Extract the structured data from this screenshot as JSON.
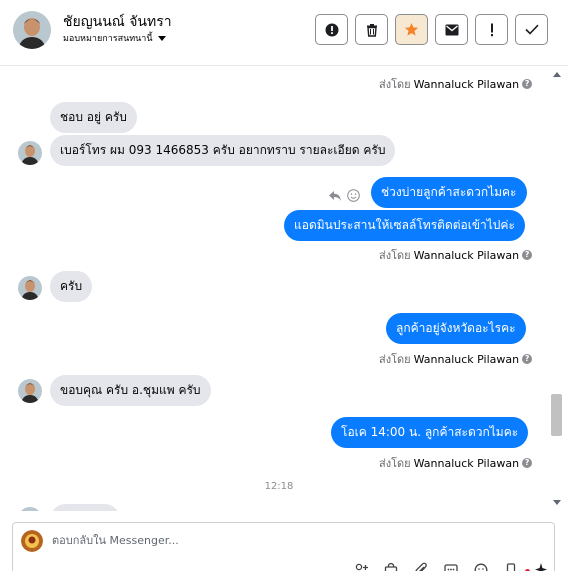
{
  "header": {
    "contact_name": "ชัยญนนณ์ จันทรา",
    "assign_label": "มอบหมายการสนทนานี้",
    "toolbar": [
      {
        "icon": "alert-circle-icon",
        "active": false
      },
      {
        "icon": "trash-icon",
        "active": false
      },
      {
        "icon": "star-icon",
        "active": true
      },
      {
        "icon": "envelope-icon",
        "active": false
      },
      {
        "icon": "exclamation-icon",
        "active": false
      },
      {
        "icon": "check-icon",
        "active": false
      }
    ]
  },
  "thread": {
    "sent_by_prefix": "ส่งโดย",
    "agent_name": "Wannaluck Pilawan",
    "messages": [
      {
        "direction": "in",
        "text": "ชอบ อยู่ ครับ"
      },
      {
        "direction": "in",
        "text": "เบอร์โทร ผม 093 1466853 ครับ อยากทราบ รายละเอียด ครับ"
      },
      {
        "direction": "out",
        "text": "ช่วงบ่ายลูกค้าสะดวกไมคะ"
      },
      {
        "direction": "out",
        "text": "แอดมินประสานให้เซลล์โทรติดต่อเข้าไปค่ะ"
      },
      {
        "direction": "in",
        "text": "ครับ"
      },
      {
        "direction": "out",
        "text": "ลูกค้าอยู่จังหวัดอะไรคะ"
      },
      {
        "direction": "in",
        "text": "ขอบคุณ ครับ อ.ชุมแพ ครับ"
      },
      {
        "direction": "out",
        "text": "โอเค 14:00 น.  ลูกค้าสะดวกไมคะ"
      }
    ],
    "time_separator": "12:18"
  },
  "composer": {
    "placeholder": "ตอบกลับใน Messenger...",
    "tools": [
      "add-friend-icon",
      "bag-icon",
      "attachment-icon",
      "saved-reply-icon",
      "emoji-icon",
      "mobile-icon",
      "sparkle-icon"
    ]
  },
  "colors": {
    "outgoing_bubble": "#0a7cff",
    "incoming_bubble": "#e4e6eb",
    "star_accent": "#f5832a"
  }
}
